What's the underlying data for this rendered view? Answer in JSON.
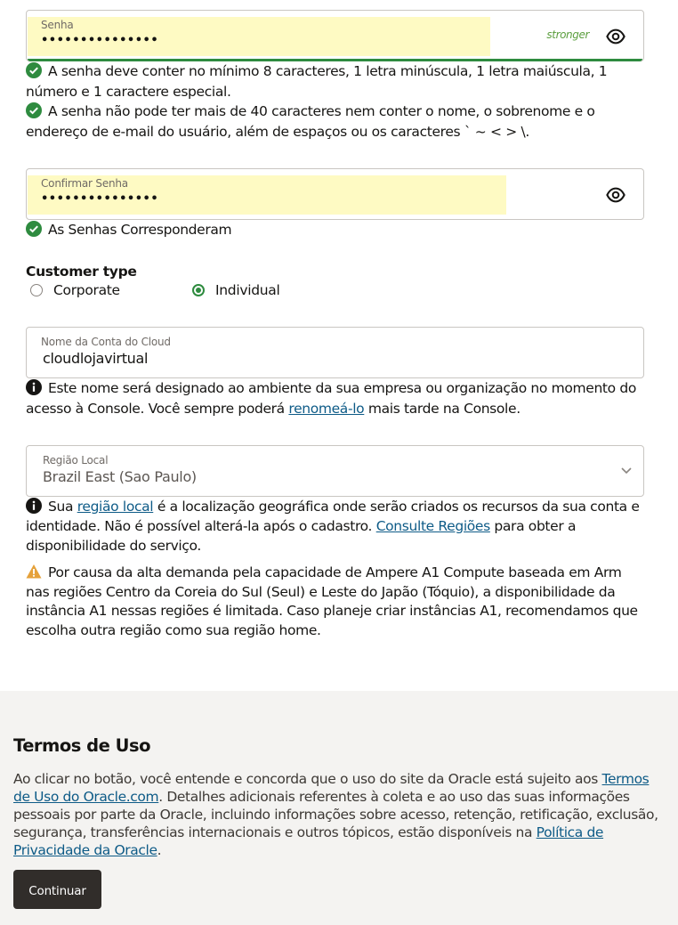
{
  "password": {
    "label": "Senha",
    "value": "•••••••••••••••",
    "strength": "stronger"
  },
  "password_rules": [
    {
      "icon": "check-circle-icon",
      "text": "A senha deve conter no mínimo 8 caracteres, 1 letra minúscula, 1 letra maiúscula, 1 número e 1 caractere especial."
    },
    {
      "icon": "check-circle-icon",
      "text": "A senha não pode ter mais de 40 caracteres nem conter o nome, o sobrenome e o endereço de e-mail do usuário, além de espaços ou os caracteres ` ~ < > \\."
    }
  ],
  "confirm_password": {
    "label": "Confirmar Senha",
    "value": "•••••••••••••••",
    "match_text": "As Senhas Corresponderam"
  },
  "customer_type": {
    "title": "Customer type",
    "options": [
      "Corporate",
      "Individual"
    ],
    "selected": "Individual"
  },
  "cloud_account": {
    "label": "Nome da Conta do Cloud",
    "value": "cloudlojavirtual",
    "info_before": "Este nome será designado ao ambiente da sua empresa ou organização no momento do acesso à Console. Você sempre poderá ",
    "info_link": "renomeá-lo",
    "info_after": " mais tarde na Console."
  },
  "home_region": {
    "label": "Região Local",
    "value": "Brazil East (Sao Paulo)",
    "info_before": "Sua ",
    "info_link1": "região local",
    "info_middle": " é a localização geográfica onde serão criados os recursos da sua conta e identidade. Não é possível alterá-la após o cadastro. ",
    "info_link2": "Consulte Regiões",
    "info_after": " para obter a disponibilidade do serviço.",
    "warning": "Por causa da alta demanda pela capacidade de Ampere A1 Compute baseada em Arm nas regiões Centro da Coreia do Sul (Seul) e Leste do Japão (Tóquio), a disponibilidade da instância A1 nessas regiões é limitada. Caso planeje criar instâncias A1, recomendamos que escolha outra região como sua região home."
  },
  "terms": {
    "title": "Termos de Uso",
    "text_before": "Ao clicar no botão, você entende e concorda que o uso do site da Oracle está sujeito aos ",
    "link1": "Termos de Uso do Oracle.com",
    "text_middle": ". Detalhes adicionais referentes à coleta e ao uso das suas informações pessoais por parte da Oracle, incluindo informações sobre acesso, retenção, retificação, exclusão, segurança, transferências internacionais e outros tópicos, estão disponíveis na ",
    "link2": "Política de Privacidade da Oracle",
    "text_after": ".",
    "button": "Continuar"
  },
  "colors": {
    "success": "#2e8b3f",
    "link": "#0e5b87",
    "autofill": "#fefac3",
    "button": "#312d2a",
    "warning": "#e5a13a"
  }
}
